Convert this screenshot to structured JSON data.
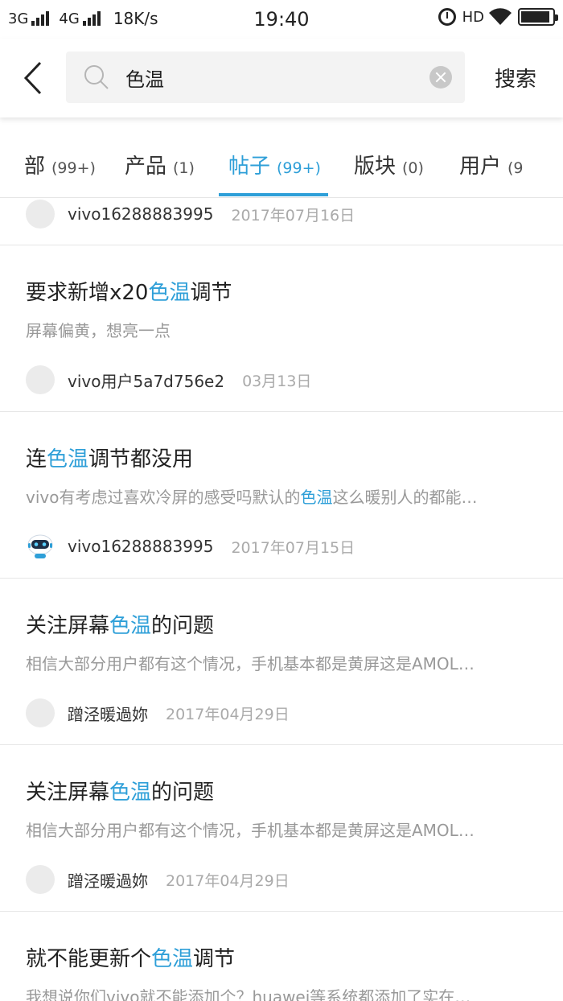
{
  "status_bar": {
    "network1": "3G",
    "network2": "4G",
    "speed": "18K/s",
    "time": "19:40",
    "hd": "HD",
    "battery_level": 0.92
  },
  "search": {
    "query": "色温",
    "button_label": "搜索"
  },
  "tabs": [
    {
      "label": "部",
      "count": "(99+)",
      "active": false
    },
    {
      "label": "产品",
      "count": "(1)",
      "active": false
    },
    {
      "label": "帖子",
      "count": "(99+)",
      "active": true
    },
    {
      "label": "版块",
      "count": "(0)",
      "active": false
    },
    {
      "label": "用户",
      "count": "(9",
      "active": false
    }
  ],
  "posts": [
    {
      "author": "vivo16288883995",
      "date": "2017年07月16日",
      "avatar": "placeholder"
    },
    {
      "title_parts": [
        "要求新增x20",
        "色温",
        "调节"
      ],
      "excerpt_parts": [
        "屏幕偏黄，想亮一点",
        "",
        ""
      ],
      "author": "vivo用户5a7d756e2",
      "date": "03月13日",
      "avatar": "placeholder"
    },
    {
      "title_parts": [
        "连",
        "色温",
        "调节都没用"
      ],
      "excerpt_parts": [
        "vivo有考虑过喜欢冷屏的感受吗默认的",
        "色温",
        "这么暖别人的都能…"
      ],
      "author": "vivo16288883995",
      "date": "2017年07月15日",
      "avatar": "robot"
    },
    {
      "title_parts": [
        "关注屏幕",
        "色温",
        "的问题"
      ],
      "excerpt_parts": [
        "相信大部分用户都有这个情况，手机基本都是黄屏这是AMOL…",
        "",
        ""
      ],
      "author": "蹭泾暖過妳",
      "date": "2017年04月29日",
      "avatar": "placeholder"
    },
    {
      "title_parts": [
        "关注屏幕",
        "色温",
        "的问题"
      ],
      "excerpt_parts": [
        "相信大部分用户都有这个情况，手机基本都是黄屏这是AMOL…",
        "",
        ""
      ],
      "author": "蹭泾暖過妳",
      "date": "2017年04月29日",
      "avatar": "placeholder"
    },
    {
      "title_parts": [
        "就不能更新个",
        "色温",
        "调节"
      ],
      "excerpt_parts": [
        "我想说你们vivo就不能添加个？huawei等系统都添加了实在…",
        "",
        ""
      ]
    }
  ],
  "colors": {
    "accent": "#2e9fd8",
    "muted_text": "#999999",
    "divider": "#e6e6e6"
  }
}
